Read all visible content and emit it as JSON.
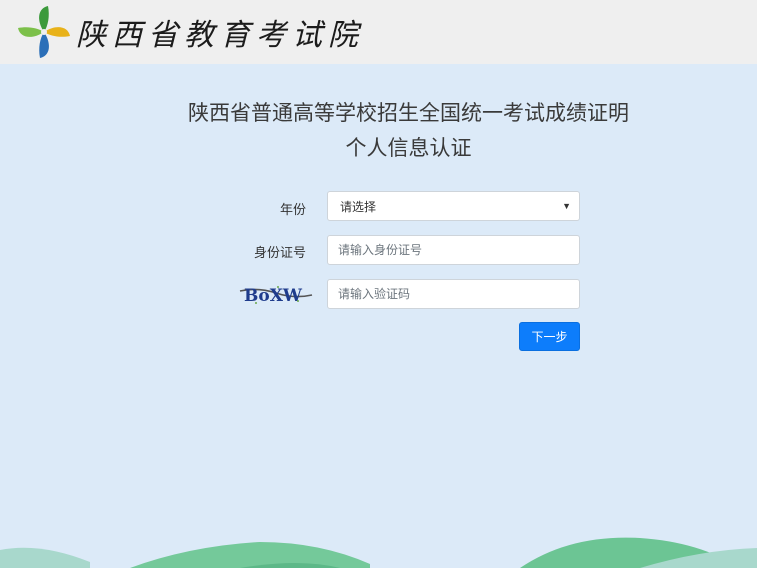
{
  "header": {
    "logo_icon": "pinwheel-logo-icon",
    "site_title": "陕西省教育考试院"
  },
  "main": {
    "title_line_1": "陕西省普通高等学校招生全国统一考试成绩证明",
    "title_line_2": "个人信息认证"
  },
  "form": {
    "year_label": "年份",
    "year_selected": "请选择",
    "id_label": "身份证号",
    "id_placeholder": "请输入身份证号",
    "captcha_text": "BoXW",
    "captcha_placeholder": "请输入验证码",
    "next_button": "下一步"
  },
  "colors": {
    "page_bg": "#dceaf8",
    "header_bg": "#efefef",
    "button_bg": "#0d7dfb",
    "wave_green": "#66c28a"
  }
}
